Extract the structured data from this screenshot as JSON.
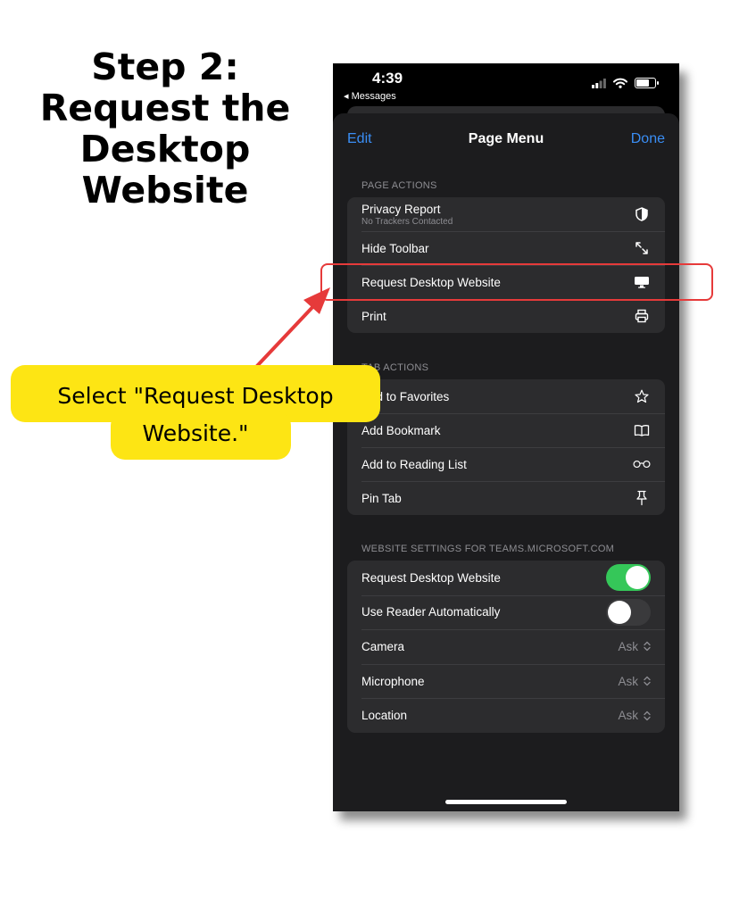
{
  "instruction": {
    "title_lines": [
      "Step 2:",
      "Request the",
      "Desktop",
      "Website"
    ],
    "callout_lines": [
      "Select \"Request Desktop",
      "Website.\""
    ]
  },
  "status_bar": {
    "time": "4:39",
    "back_label": "◂ Messages"
  },
  "nav": {
    "edit": "Edit",
    "title": "Page Menu",
    "done": "Done"
  },
  "page_actions": {
    "label": "PAGE ACTIONS",
    "items": [
      {
        "label": "Privacy Report",
        "sublabel": "No Trackers Contacted",
        "icon": "shield-icon"
      },
      {
        "label": "Hide Toolbar",
        "icon": "expand-arrows-icon"
      },
      {
        "label": "Request Desktop Website",
        "icon": "desktop-icon"
      },
      {
        "label": "Print",
        "icon": "printer-icon"
      }
    ]
  },
  "tab_actions": {
    "label": "TAB ACTIONS",
    "items": [
      {
        "label": "Add to Favorites",
        "icon": "star-icon"
      },
      {
        "label": "Add Bookmark",
        "icon": "book-icon"
      },
      {
        "label": "Add to Reading List",
        "icon": "glasses-icon"
      },
      {
        "label": "Pin Tab",
        "icon": "pin-icon"
      }
    ]
  },
  "website_settings": {
    "label": "WEBSITE SETTINGS FOR TEAMS.MICROSOFT.COM",
    "toggles": [
      {
        "label": "Request Desktop Website",
        "on": true
      },
      {
        "label": "Use Reader Automatically",
        "on": false
      }
    ],
    "selects": [
      {
        "label": "Camera",
        "value": "Ask"
      },
      {
        "label": "Microphone",
        "value": "Ask"
      },
      {
        "label": "Location",
        "value": "Ask"
      }
    ]
  },
  "colors": {
    "accent_blue": "#3a8ef5",
    "toggle_on_green": "#35c759",
    "highlight_red": "#e63a3a",
    "callout_yellow": "#fde514"
  }
}
